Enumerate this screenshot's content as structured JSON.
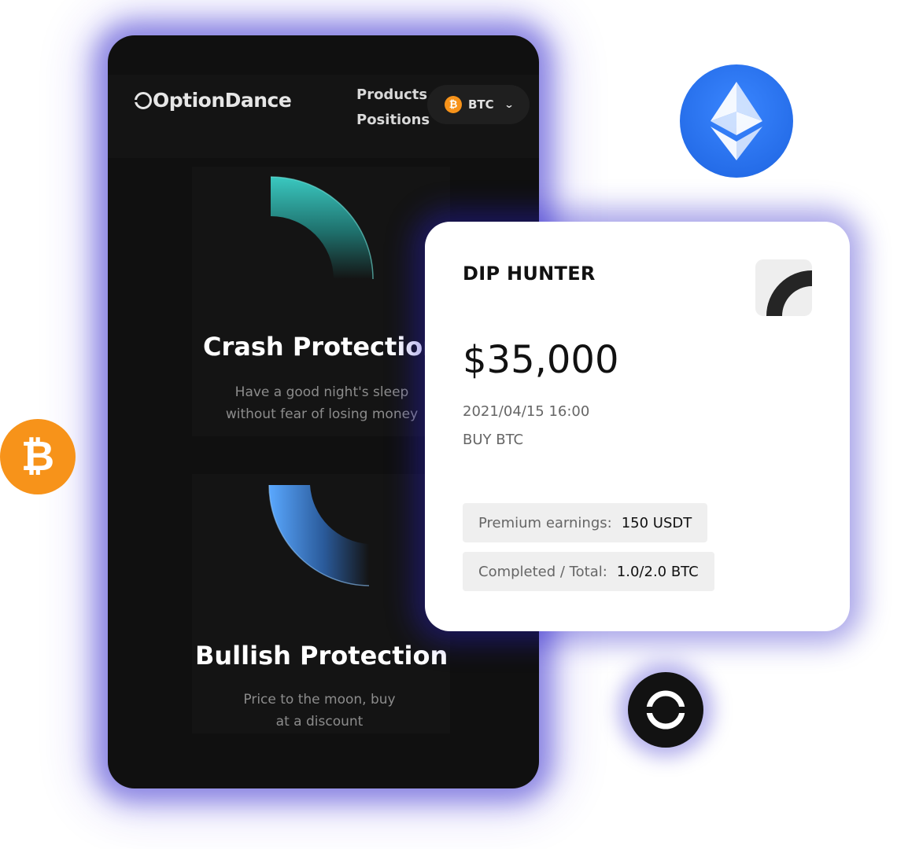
{
  "app": {
    "brand": "OptionDance",
    "nav": [
      "Products",
      "Positions"
    ],
    "coin_selector": "BTC"
  },
  "cards": [
    {
      "title": "Crash Protection",
      "desc": [
        "Have a good night's sleep",
        "without fear of losing money"
      ]
    },
    {
      "title": "Bullish Protection",
      "desc": [
        "Price to the moon, buy",
        "at a discount"
      ]
    }
  ],
  "dip": {
    "title": "DIP HUNTER",
    "price": "$35,000",
    "date": "2021/04/15 16:00",
    "action": "BUY BTC",
    "premium_label": "Premium earnings:",
    "premium_value": "150 USDT",
    "completed_label": "Completed / Total:",
    "completed_value": "1.0/2.0 BTC"
  },
  "coins": {
    "btc_symbol": "₿"
  },
  "colors": {
    "accent_teal": "#3ac8c0",
    "accent_blue": "#5aa8ff",
    "btc_orange": "#f7931a",
    "eth_blue": "#2573f0",
    "glow": "#2a1ec8"
  }
}
